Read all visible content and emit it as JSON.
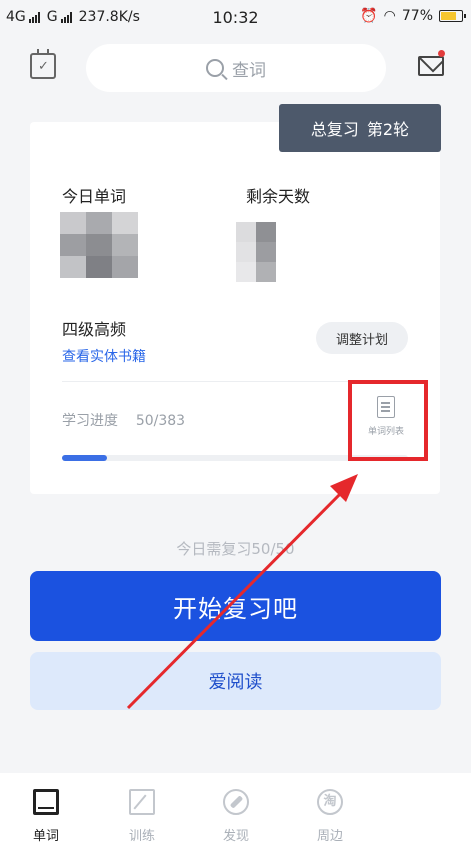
{
  "status_bar": {
    "network1": "4G",
    "network2": "G",
    "speed": "237.8K/s",
    "time": "10:32",
    "battery": "77%"
  },
  "header": {
    "search_placeholder": "查词",
    "icons": [
      "calendar-check-icon",
      "search-icon",
      "mail-icon"
    ]
  },
  "card": {
    "round_label": "总复习",
    "round_value": "第2轮",
    "today_words_label": "今日单词",
    "days_left_label": "剩余天数",
    "plan_name": "四级高频",
    "book_link": "查看实体书籍",
    "adjust_button": "调整计划",
    "progress_label": "学习进度",
    "progress_value": "50/383",
    "progress_fraction": 0.1305,
    "word_list_label": "单词列表"
  },
  "main": {
    "review_count": "今日需复习50/50",
    "start_button": "开始复习吧",
    "read_button": "爱阅读"
  },
  "tabs": [
    {
      "label": "单词",
      "icon": "book-icon",
      "active": true
    },
    {
      "label": "训练",
      "icon": "edit-icon",
      "active": false
    },
    {
      "label": "发现",
      "icon": "compass-icon",
      "active": false
    },
    {
      "label": "周边",
      "icon": "shop-icon",
      "active": false
    }
  ],
  "colors": {
    "primary": "#1b52e0",
    "badge": "#4d596b",
    "highlight": "#e5282c"
  }
}
